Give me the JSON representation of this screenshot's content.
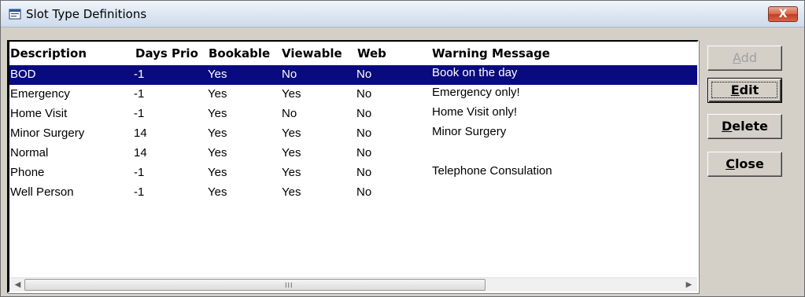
{
  "window": {
    "title": "Slot Type Definitions",
    "close_label": "X"
  },
  "table": {
    "columns": [
      "Description",
      "Days Prio",
      "Bookable",
      "Viewable",
      "Web",
      "Warning Message"
    ],
    "rows": [
      {
        "description": "BOD",
        "days_prio": "-1",
        "bookable": "Yes",
        "viewable": "No",
        "web": "No",
        "warning": "Book on the day",
        "selected": true
      },
      {
        "description": "Emergency",
        "days_prio": "-1",
        "bookable": "Yes",
        "viewable": "Yes",
        "web": "No",
        "warning": "Emergency only!"
      },
      {
        "description": "Home Visit",
        "days_prio": "-1",
        "bookable": "Yes",
        "viewable": "No",
        "web": "No",
        "warning": "Home Visit only!"
      },
      {
        "description": "Minor Surgery",
        "days_prio": "14",
        "bookable": "Yes",
        "viewable": "Yes",
        "web": "No",
        "warning": "Minor Surgery"
      },
      {
        "description": "Normal",
        "days_prio": "14",
        "bookable": "Yes",
        "viewable": "Yes",
        "web": "No",
        "warning": ""
      },
      {
        "description": "Phone",
        "days_prio": "-1",
        "bookable": "Yes",
        "viewable": "Yes",
        "web": "No",
        "warning": "Telephone Consulation"
      },
      {
        "description": "Well Person",
        "days_prio": "-1",
        "bookable": "Yes",
        "viewable": "Yes",
        "web": "No",
        "warning": ""
      }
    ],
    "scroll_grip": "III"
  },
  "buttons": {
    "add": {
      "first": "A",
      "rest": "dd"
    },
    "edit": {
      "first": "E",
      "rest": "dit"
    },
    "delete": {
      "first": "D",
      "rest": "elete"
    },
    "close": {
      "first": "C",
      "rest": "lose"
    }
  },
  "colors": {
    "selection": "#0a0a80",
    "face": "#d4d0c8"
  }
}
